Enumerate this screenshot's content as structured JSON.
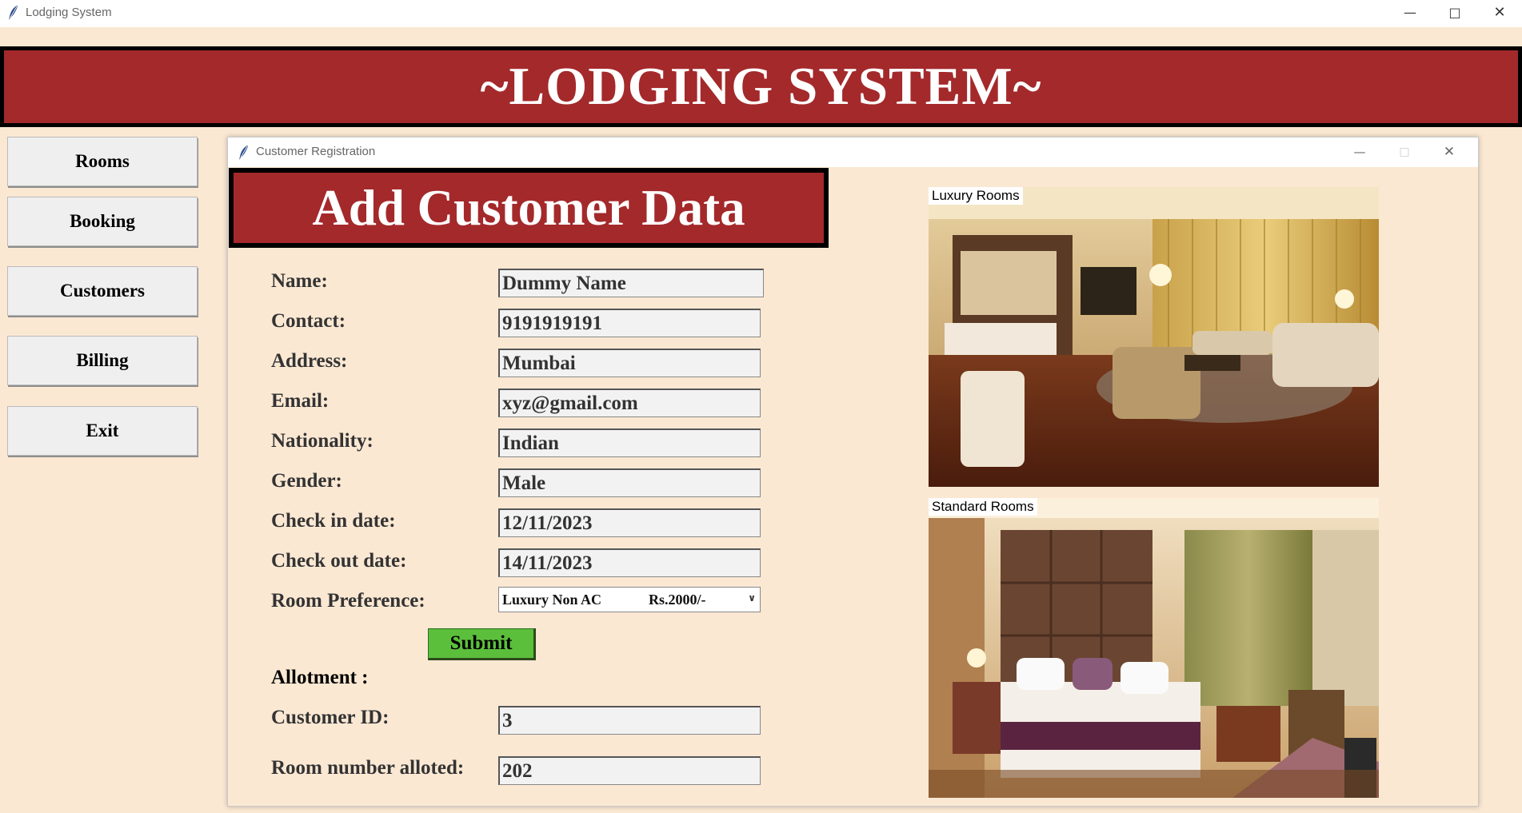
{
  "window": {
    "title": "Lodging System"
  },
  "banner": {
    "title": "~LODGING SYSTEM~"
  },
  "sidebar": {
    "items": [
      {
        "label": "Rooms"
      },
      {
        "label": "Booking"
      },
      {
        "label": "Customers"
      },
      {
        "label": "Billing"
      },
      {
        "label": "Exit"
      }
    ]
  },
  "dialog": {
    "title": "Customer Registration",
    "heading": "Add Customer Data",
    "form": {
      "name": {
        "label": "Name:",
        "value": "Dummy Name"
      },
      "contact": {
        "label": "Contact:",
        "value": "9191919191"
      },
      "address": {
        "label": "Address:",
        "value": "Mumbai"
      },
      "email": {
        "label": "Email:",
        "value": "xyz@gmail.com"
      },
      "nationality": {
        "label": "Nationality:",
        "value": "Indian"
      },
      "gender": {
        "label": "Gender:",
        "value": "Male"
      },
      "checkin": {
        "label": "Check in date:",
        "value": "12/11/2023"
      },
      "checkout": {
        "label": "Check out date:",
        "value": "14/11/2023"
      },
      "room_pref": {
        "label": "Room Preference:",
        "selected_type": "Luxury Non AC",
        "selected_price": "Rs.2000/-"
      }
    },
    "submit_label": "Submit",
    "allotment": {
      "heading": "Allotment :",
      "customer_id": {
        "label": "Customer ID:",
        "value": "3"
      },
      "room_number": {
        "label": "Room number alloted:",
        "value": "202"
      }
    },
    "images": [
      {
        "label": "Luxury Rooms"
      },
      {
        "label": "Standard Rooms"
      }
    ]
  },
  "colors": {
    "background": "#fbe8d3",
    "banner": "#a4292b",
    "submit": "#5cbf3c"
  }
}
